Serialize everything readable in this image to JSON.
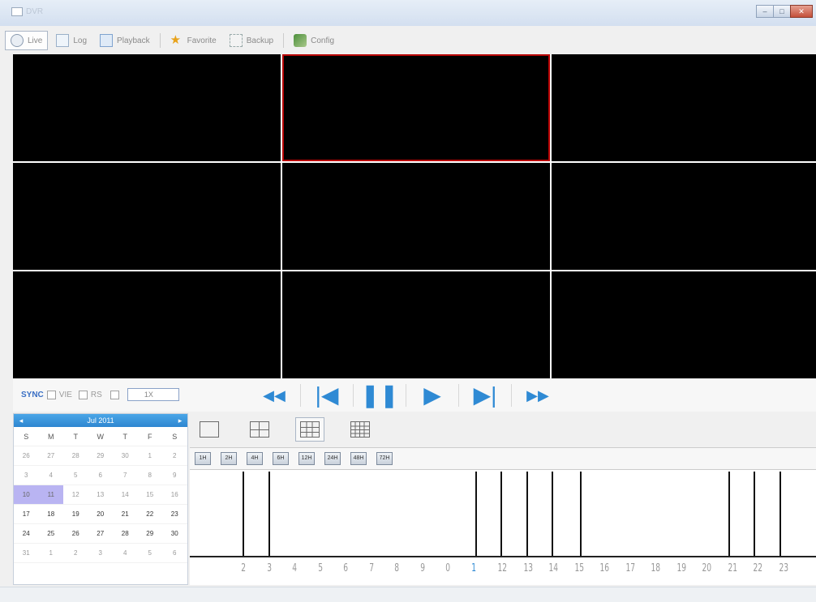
{
  "window": {
    "title": "DVR",
    "controls": {
      "minimize": "–",
      "maximize": "□",
      "close": "✕"
    }
  },
  "toolbar": {
    "items": [
      {
        "label": "Live",
        "icon": "camera-icon",
        "active": true
      },
      {
        "label": "Log",
        "icon": "document-icon",
        "active": false
      },
      {
        "label": "Playback",
        "icon": "playback-icon",
        "active": false
      },
      {
        "label": "Favorite",
        "icon": "star-icon",
        "active": false
      },
      {
        "label": "Backup",
        "icon": "backup-icon",
        "active": false
      },
      {
        "label": "Config",
        "icon": "settings-icon",
        "active": false
      }
    ]
  },
  "video_grid": {
    "rows": 3,
    "cols": 3,
    "selected_index": 1
  },
  "playback": {
    "sync_label": "SYNC",
    "option1_label": "VIE",
    "option2_label": "RS",
    "speed_value": "1X",
    "buttons": [
      "fast-backward-icon",
      "skip-back-icon",
      "pause-icon",
      "play-icon",
      "skip-forward-icon",
      "fast-forward-icon"
    ]
  },
  "calendar": {
    "month_label": "Jul 2011",
    "weekdays": [
      "S",
      "M",
      "T",
      "W",
      "T",
      "F",
      "S"
    ],
    "weeks": [
      [
        "26",
        "27",
        "28",
        "29",
        "30",
        "1",
        "2"
      ],
      [
        "3",
        "4",
        "5",
        "6",
        "7",
        "8",
        "9"
      ],
      [
        "10",
        "11",
        "12",
        "13",
        "14",
        "15",
        "16"
      ],
      [
        "17",
        "18",
        "19",
        "20",
        "21",
        "22",
        "23"
      ],
      [
        "24",
        "25",
        "26",
        "27",
        "28",
        "29",
        "30"
      ],
      [
        "31",
        "1",
        "2",
        "3",
        "4",
        "5",
        "6"
      ]
    ],
    "highlight": [
      [
        2,
        0
      ],
      [
        2,
        1
      ]
    ]
  },
  "view_modes": [
    {
      "icon": "single-view-icon",
      "active": false
    },
    {
      "icon": "quad-view-icon",
      "active": false
    },
    {
      "icon": "nine-view-icon",
      "active": true
    },
    {
      "icon": "sixteen-view-icon",
      "active": false
    }
  ],
  "zoom": [
    "1H",
    "2H",
    "4H",
    "6H",
    "12H",
    "24H",
    "48H",
    "72H"
  ],
  "timeline": {
    "labels": [
      "2",
      "3",
      "4",
      "5",
      "6",
      "7",
      "8",
      "9",
      "0",
      "1",
      "12",
      "13",
      "14",
      "15",
      "16",
      "17",
      "18",
      "19",
      "20",
      "21",
      "22",
      "23"
    ],
    "current_label_index": 9,
    "records": [
      2.1,
      3.1,
      11.2,
      12.2,
      13.2,
      14.2,
      15.3,
      21.1,
      22.1,
      23.1
    ]
  }
}
